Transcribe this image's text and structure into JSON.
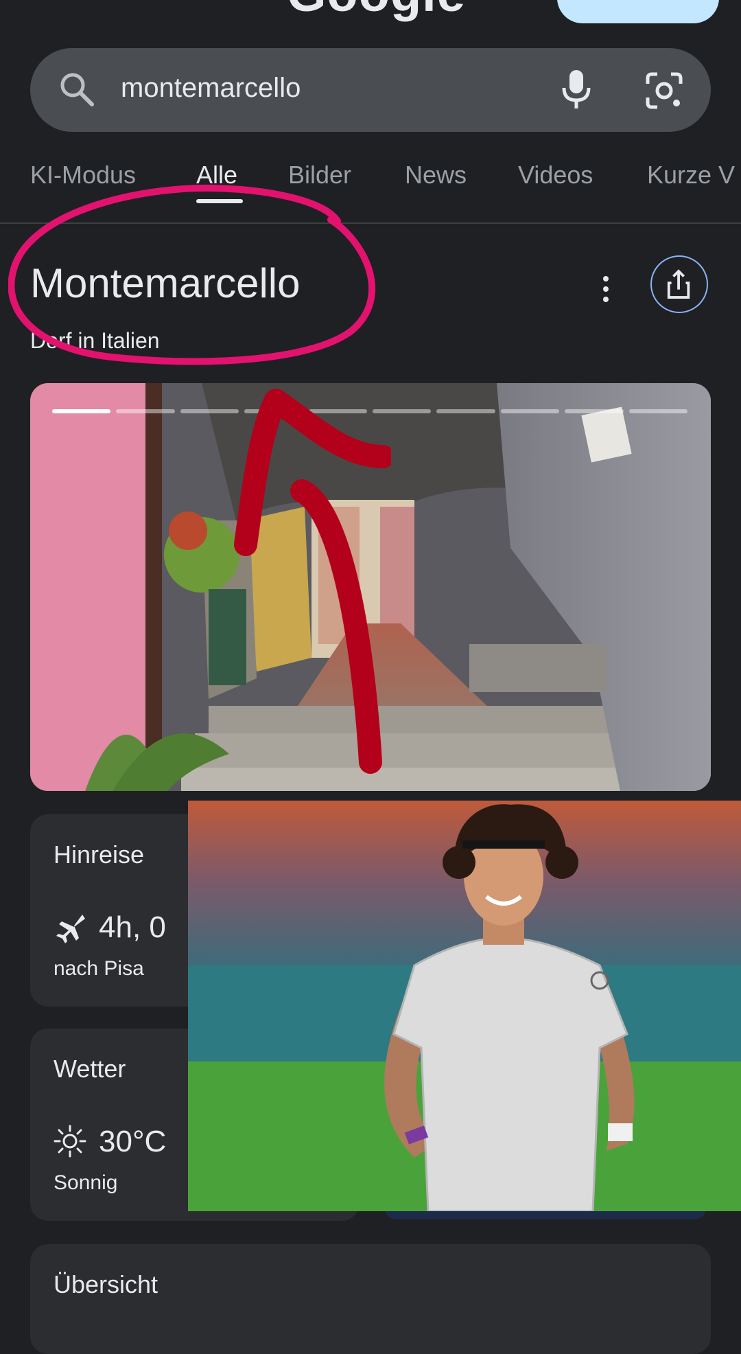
{
  "header": {
    "logo_text": "Google"
  },
  "search": {
    "query": "montemarcello"
  },
  "tabs": [
    {
      "label": "KI-Modus"
    },
    {
      "label": "Alle"
    },
    {
      "label": "Bilder"
    },
    {
      "label": "News"
    },
    {
      "label": "Videos"
    },
    {
      "label": "Kurze V"
    }
  ],
  "entity": {
    "title": "Montemarcello",
    "subtitle": "Dorf in Italien"
  },
  "cards": {
    "travel": {
      "label": "Hinreise",
      "value": "4h, 0",
      "sub": "nach Pisa"
    },
    "weather": {
      "label": "Wetter",
      "value": "30°C",
      "sub": "Sonnig"
    },
    "overview": {
      "label": "Übersicht"
    }
  },
  "colors": {
    "background": "#1f2023",
    "search_bar": "#4a4d51",
    "annotation_pink": "#e3126f",
    "annotation_red": "#b3001b"
  }
}
